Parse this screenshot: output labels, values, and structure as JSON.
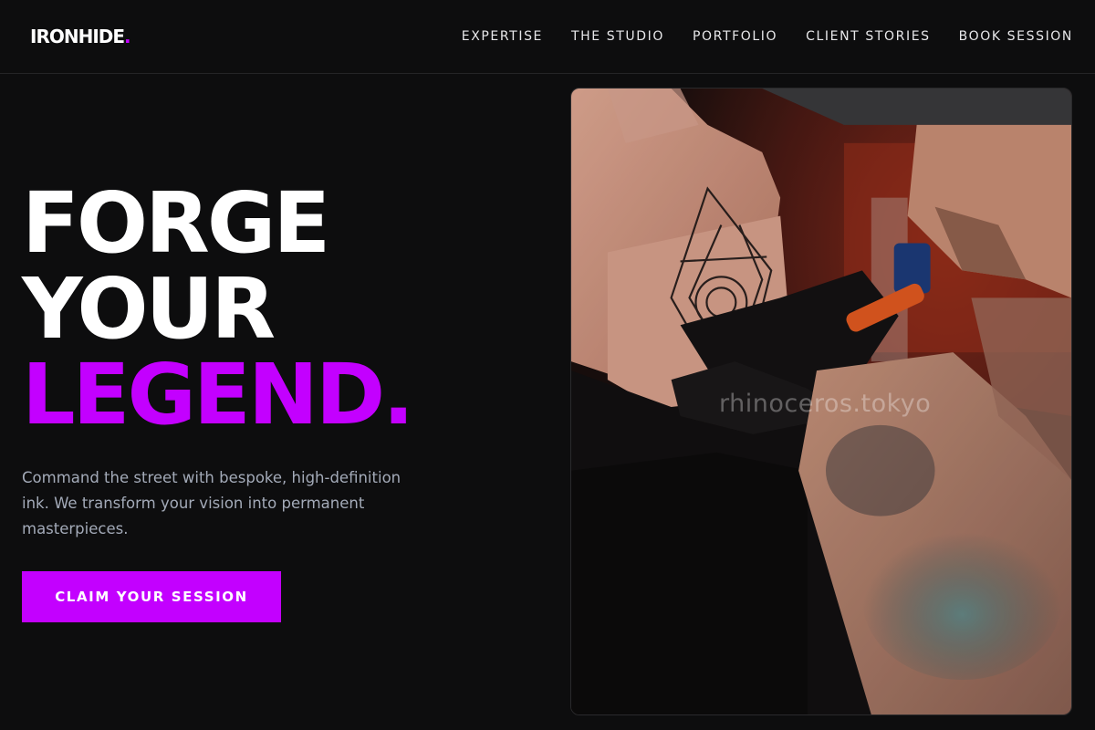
{
  "brand": {
    "name": "IRONHIDE",
    "dot": "."
  },
  "nav": {
    "items": [
      {
        "label": "EXPERTISE"
      },
      {
        "label": "THE STUDIO"
      },
      {
        "label": "PORTFOLIO"
      },
      {
        "label": "CLIENT STORIES"
      },
      {
        "label": "BOOK SESSION"
      }
    ]
  },
  "hero": {
    "title_line1": "FORGE",
    "title_line2": "YOUR",
    "title_line3": "LEGEND.",
    "description": "Command the street with bespoke, high-definition ink. We transform your vision into permanent masterpieces.",
    "cta_label": "CLAIM YOUR SESSION",
    "image_watermark": "rhinoceros.tokyo"
  },
  "colors": {
    "accent": "#c300ff",
    "background": "#0d0d0e",
    "body_text": "#a3aab8"
  }
}
